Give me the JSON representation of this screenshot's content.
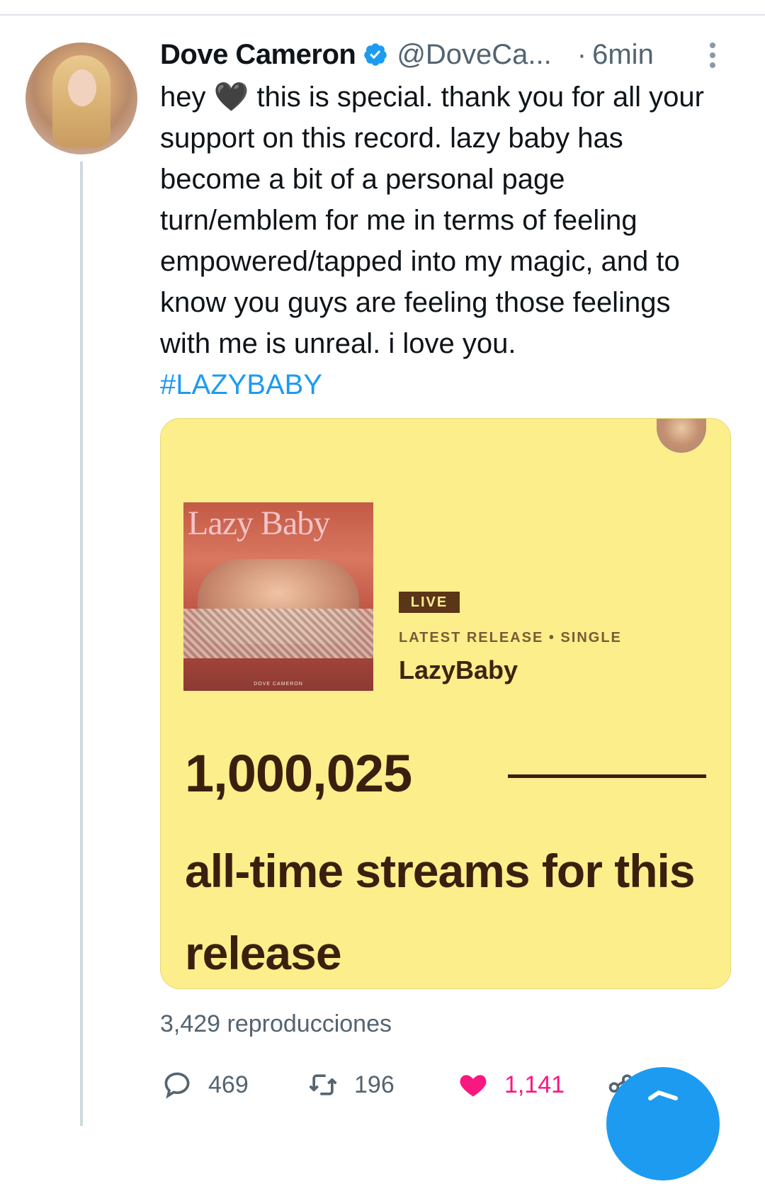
{
  "tweet": {
    "author_name": "Dove Cameron",
    "handle": "@DoveCa...",
    "separator": "·",
    "time": "6min",
    "text": "hey 🖤 this is special. thank you for all your support on this record. lazy baby has become a bit of a personal page turn/emblem for me in terms of feeling empowered/tapped into my magic, and to know you guys are feeling those feelings with me is unreal. i love you.",
    "hashtag": "#LAZYBABY",
    "views": "3,429 reproducciones"
  },
  "card": {
    "cover_title": "Lazy Baby",
    "cover_credit": "DOVE CAMERON",
    "badge": "LIVE",
    "release_label": "LATEST RELEASE • SINGLE",
    "release_name": "LazyBaby",
    "streams": "1,000,025",
    "caption": "all-time streams for this release",
    "background_color": "#fcee8b",
    "text_color": "#3b1f0e"
  },
  "actions": {
    "replies": "469",
    "retweets": "196",
    "likes": "1,141"
  },
  "colors": {
    "link": "#1d9bf0",
    "muted": "#536471",
    "like": "#f91880"
  },
  "icons": [
    "verified-icon",
    "more-icon",
    "reply-icon",
    "retweet-icon",
    "heart-icon",
    "share-icon",
    "compose-icon"
  ]
}
